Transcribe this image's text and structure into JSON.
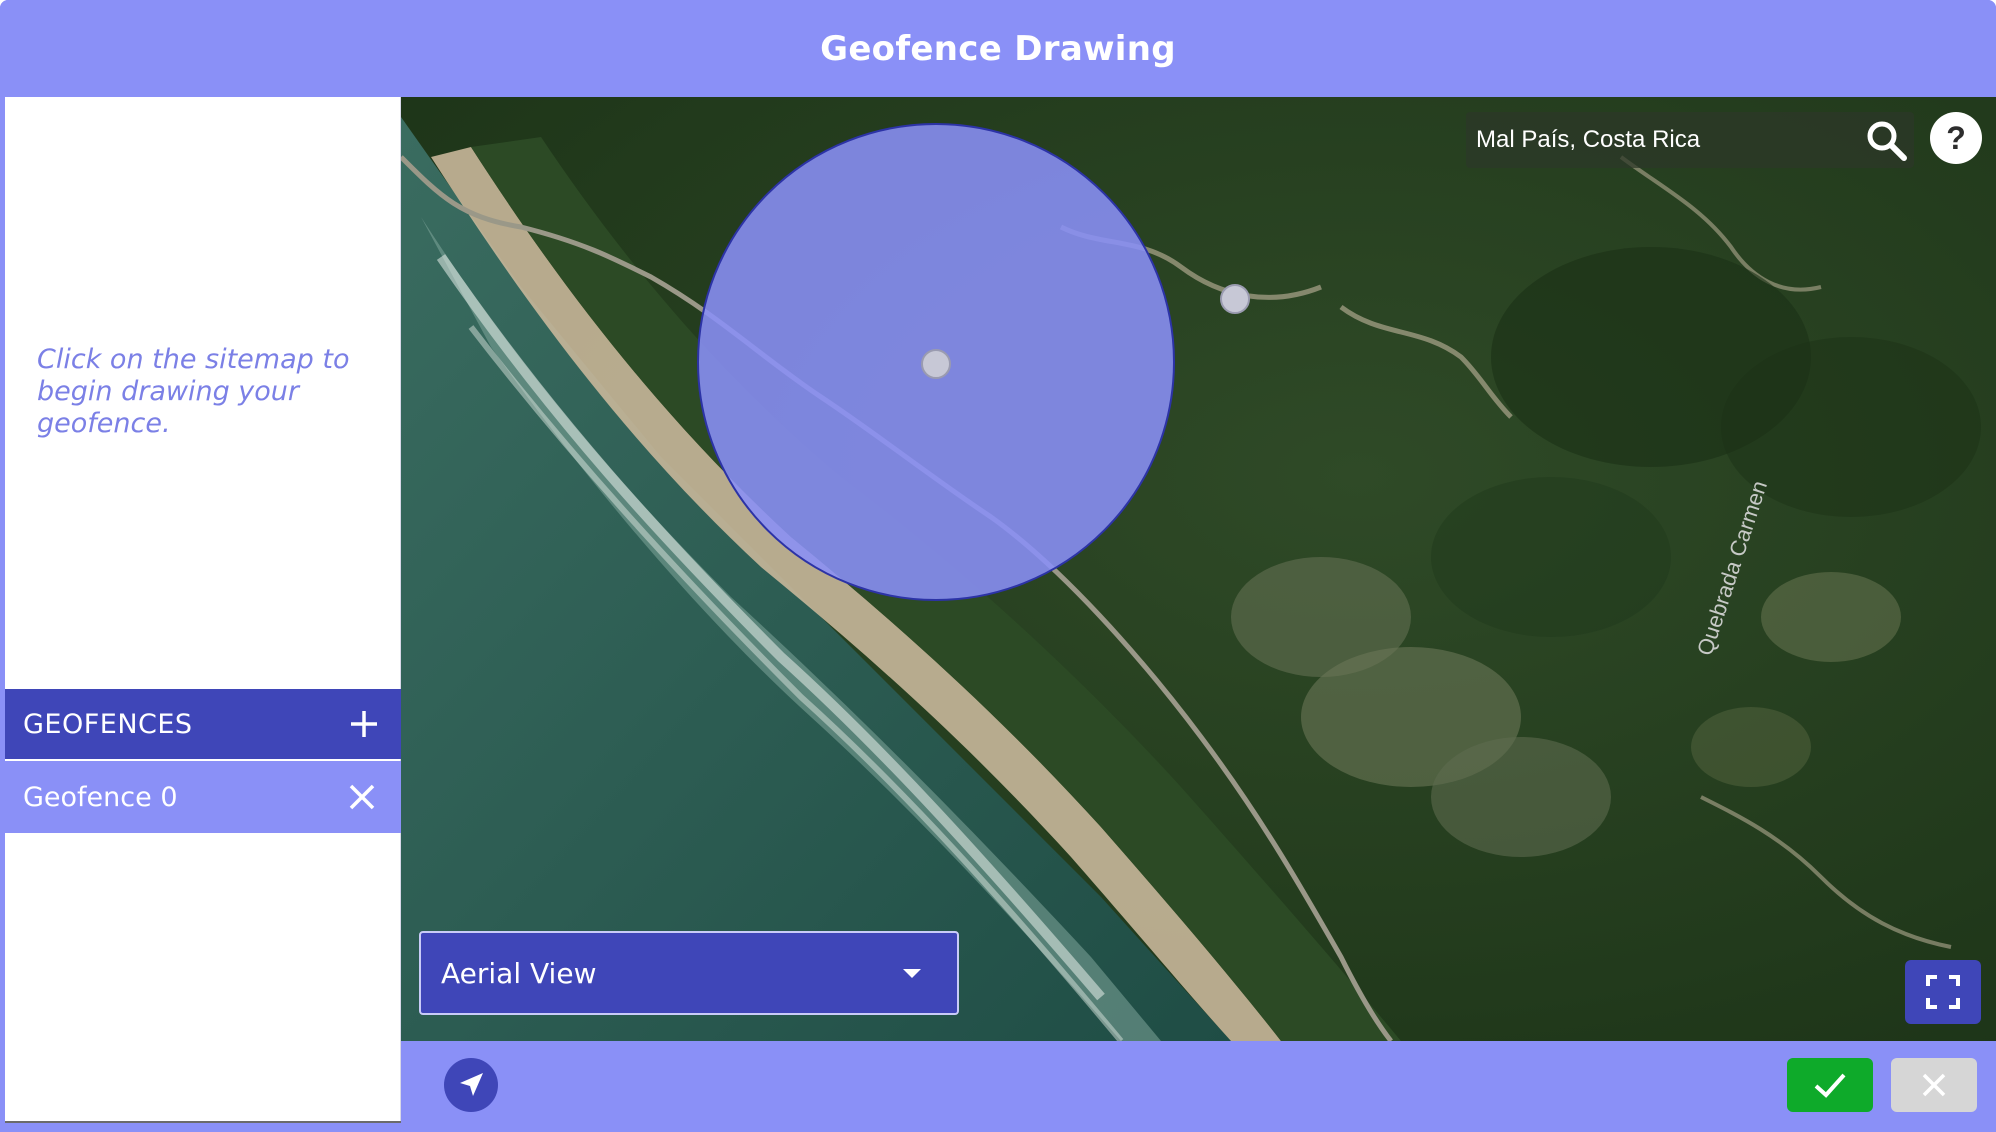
{
  "header": {
    "title": "Geofence Drawing"
  },
  "sidebar": {
    "hint": "Click on the sitemap to begin drawing your geofence.",
    "geofences_header": "GEOFENCES",
    "add_icon": "plus-icon",
    "items": [
      {
        "label": "Geofence 0",
        "remove_icon": "close-icon"
      }
    ]
  },
  "map": {
    "search": {
      "value": "Mal País, Costa Rica",
      "icon": "search-icon"
    },
    "help": {
      "label": "?"
    },
    "road_label": "Quebrada Carmen",
    "view_select": {
      "selected": "Aerial View",
      "icon": "chevron-down-icon"
    },
    "fullscreen_icon": "fullscreen-icon",
    "geofence_circle": {
      "fill": "#8a90f7"
    }
  },
  "footer": {
    "locate_icon": "location-arrow-icon",
    "confirm_icon": "checkmark-icon",
    "cancel_icon": "close-icon"
  },
  "colors": {
    "accent": "#8a90f7",
    "accent_dark": "#3f46b8",
    "confirm": "#0eaa2a",
    "cancel": "#d6d6d6",
    "hint": "#7b80e6"
  }
}
